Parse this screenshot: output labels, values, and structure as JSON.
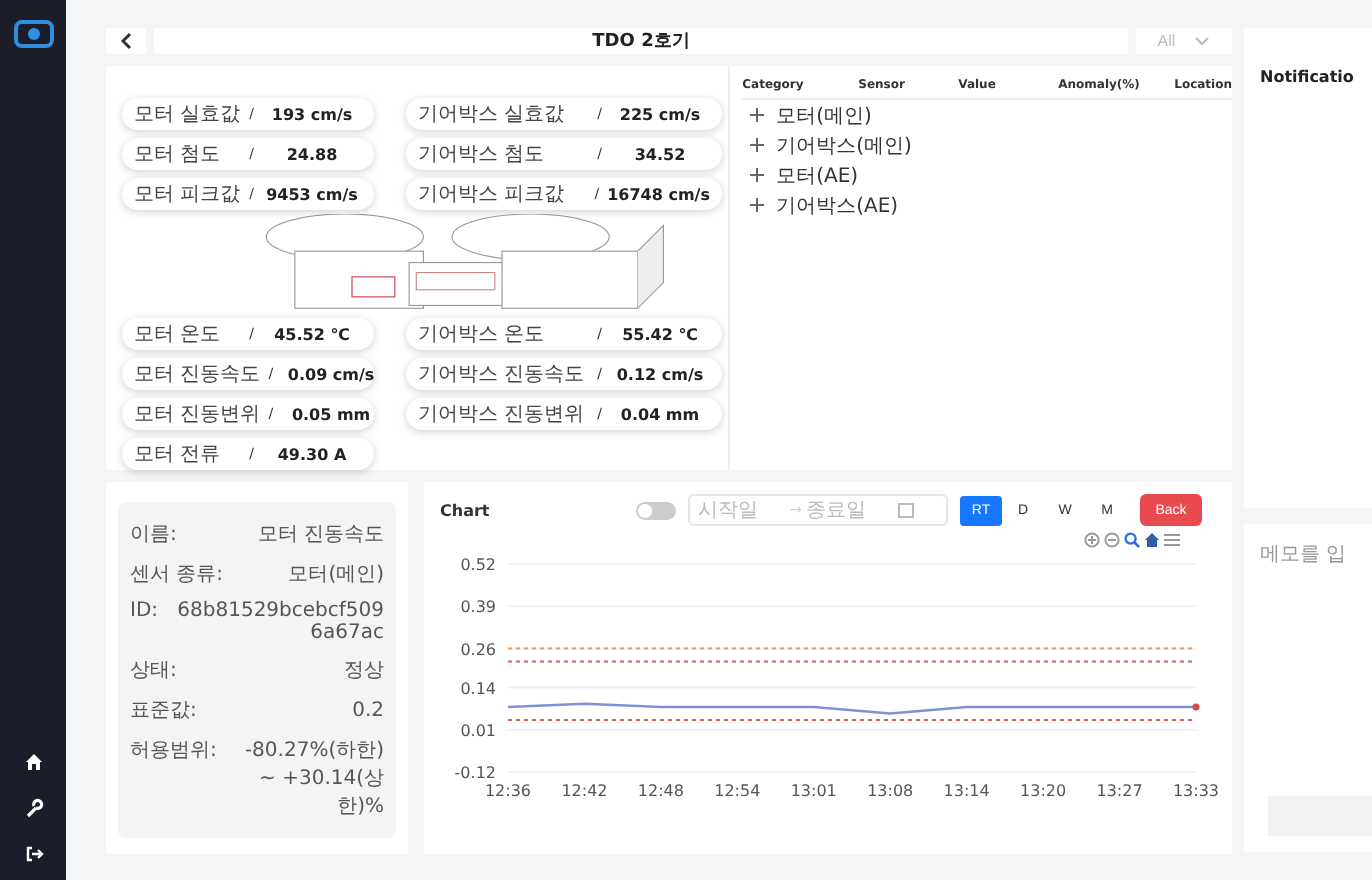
{
  "header": {
    "title": "TDO 2호기",
    "filter": "All"
  },
  "gauges_top_left": [
    {
      "label": "모터 실효값",
      "value": "193 cm/s"
    },
    {
      "label": "모터 첨도",
      "value": "24.88"
    },
    {
      "label": "모터 피크값",
      "value": "9453 cm/s"
    }
  ],
  "gauges_top_right": [
    {
      "label": "기어박스 실효값",
      "value": "225 cm/s"
    },
    {
      "label": "기어박스 첨도",
      "value": "34.52"
    },
    {
      "label": "기어박스 피크값",
      "value": "16748 cm/s"
    }
  ],
  "gauges_bottom_left": [
    {
      "label": "모터 온도",
      "value": "45.52 ℃"
    },
    {
      "label": "모터 진동속도",
      "value": "0.09 cm/s"
    },
    {
      "label": "모터 진동변위",
      "value": "0.05 mm"
    },
    {
      "label": "모터 전류",
      "value": "49.30 A"
    }
  ],
  "gauges_bottom_right": [
    {
      "label": "기어박스 온도",
      "value": "55.42 ℃"
    },
    {
      "label": "기어박스 진동속도",
      "value": "0.12 cm/s"
    },
    {
      "label": "기어박스 진동변위",
      "value": "0.04 mm"
    }
  ],
  "separator": "/",
  "sensor_table": {
    "columns": [
      "Category",
      "Sensor",
      "Value",
      "Anomaly(%)",
      "Location"
    ],
    "rows": [
      {
        "category": "모터(메인)",
        "expanded": false
      },
      {
        "category": "기어박스(메인)",
        "expanded": false
      },
      {
        "category": "모터(AE)",
        "expanded": false
      },
      {
        "category": "기어박스(AE)",
        "expanded": false
      }
    ]
  },
  "notification": {
    "title": "Notificatio"
  },
  "details": [
    {
      "label": "이름:",
      "value": "모터 진동속도"
    },
    {
      "label": "센서 종류:",
      "value": "모터(메인)"
    },
    {
      "label": "ID:",
      "value": "68b81529bcebcf5096a67ac"
    },
    {
      "label": "상태:",
      "value": "정상"
    },
    {
      "label": "표준값:",
      "value": "0.2"
    },
    {
      "label": "허용범위:",
      "value": "-80.27%(하한) ~ +30.14(상한)%"
    }
  ],
  "chart_panel": {
    "title": "Chart",
    "toggle_on": false,
    "start_placeholder": "시작일",
    "end_placeholder": "종료일",
    "ranges": [
      {
        "label": "RT",
        "selected": true
      },
      {
        "label": "D",
        "selected": false
      },
      {
        "label": "W",
        "selected": false
      },
      {
        "label": "M",
        "selected": false
      }
    ],
    "back_button": "Back",
    "chart_data": {
      "type": "line",
      "categories": [
        "12:36",
        "12:42",
        "12:48",
        "12:54",
        "13:01",
        "13:08",
        "13:14",
        "13:20",
        "13:27",
        "13:33"
      ],
      "grid": true,
      "series": [
        {
          "color": "#7b93d6",
          "line_style": "solid",
          "values": [
            0.08,
            0.09,
            0.08,
            0.08,
            0.08,
            0.06,
            0.08,
            0.08,
            0.08,
            0.08
          ]
        },
        {
          "color": "#e0a060",
          "line_style": "dashed",
          "values": [
            0.26,
            0.26,
            0.26,
            0.26,
            0.26,
            0.26,
            0.26,
            0.26,
            0.26,
            0.26
          ]
        },
        {
          "color": "#d06060",
          "line_style": "dashed",
          "values": [
            0.22,
            0.22,
            0.22,
            0.22,
            0.22,
            0.22,
            0.22,
            0.22,
            0.22,
            0.22
          ]
        },
        {
          "color": "#d06060",
          "line_style": "dashed",
          "values": [
            0.04,
            0.04,
            0.04,
            0.04,
            0.04,
            0.04,
            0.04,
            0.04,
            0.04,
            0.04
          ]
        }
      ],
      "yticks": [
        0.52,
        0.39,
        0.26,
        0.14,
        0.01,
        -0.12
      ],
      "ylim": [
        -0.12,
        0.52
      ]
    },
    "date_separator": "→"
  },
  "memo": {
    "placeholder": "메모를 입"
  }
}
